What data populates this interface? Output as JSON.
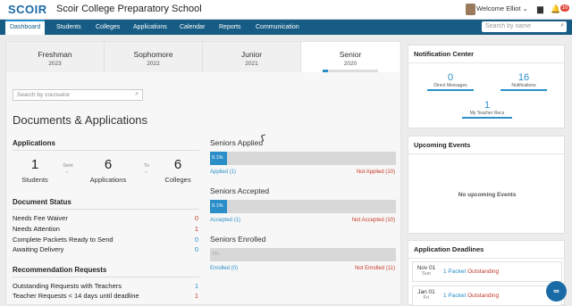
{
  "header": {
    "logo": "SCOIR",
    "school_name": "Scoir College Preparatory School",
    "welcome": "Welcome Elliot ⌄",
    "notification_badge": "10"
  },
  "nav": {
    "tabs": [
      "Dashboard",
      "Students",
      "Colleges",
      "Applications",
      "Calendar",
      "Reports",
      "Communication"
    ],
    "search_placeholder": "Search by name"
  },
  "class_tabs": [
    {
      "name": "Freshman",
      "year": "2023"
    },
    {
      "name": "Sophomore",
      "year": "2022"
    },
    {
      "name": "Junior",
      "year": "2021"
    },
    {
      "name": "Senior",
      "year": "2020",
      "progress": 0.091
    }
  ],
  "counselor_search": {
    "placeholder": "Search by counselor"
  },
  "page_title": "Documents & Applications",
  "applications": {
    "heading": "Applications",
    "students_count": "1",
    "students_label": "Students",
    "sent_label": "Sent",
    "applications_count": "6",
    "applications_label": "Applications",
    "to_label": "To",
    "colleges_count": "6",
    "colleges_label": "Colleges"
  },
  "document_status": {
    "heading": "Document Status",
    "rows": [
      {
        "label": "Needs Fee Waiver",
        "value": "0",
        "color": "#c53a2a"
      },
      {
        "label": "Needs Attention",
        "value": "1",
        "color": "#c53a2a"
      },
      {
        "label": "Complete Packets Ready to Send",
        "value": "0",
        "color": "#2a8ec8"
      },
      {
        "label": "Awaiting Delivery",
        "value": "0",
        "color": "#2a8ec8"
      }
    ]
  },
  "recommendation_requests": {
    "heading": "Recommendation Requests",
    "rows": [
      {
        "label": "Outstanding Requests with Teachers",
        "value": "1",
        "color": "#2a8ec8"
      },
      {
        "label": "Teacher Requests < 14 days until deadline",
        "value": "1",
        "color": "#c53a2a"
      }
    ]
  },
  "senior_bars": [
    {
      "title": "Seniors Applied",
      "percent_label": "9.1%",
      "fraction": 0.091,
      "left_label": "Applied (1)",
      "right_label": "Not Applied (10)"
    },
    {
      "title": "Seniors Accepted",
      "percent_label": "9.1%",
      "fraction": 0.091,
      "left_label": "Accepted (1)",
      "right_label": "Not Accepted (10)"
    },
    {
      "title": "Seniors Enrolled",
      "percent_label": "0%",
      "fraction": 0,
      "left_label": "Enrolled (0)",
      "right_label": "Not Enrolled (11)"
    }
  ],
  "notification_center": {
    "heading": "Notification Center",
    "items": [
      {
        "count": "0",
        "label": "Direct Messages"
      },
      {
        "count": "16",
        "label": "Notifications"
      },
      {
        "count": "1",
        "label": "My Teacher Recs"
      }
    ]
  },
  "upcoming_events": {
    "heading": "Upcoming Events",
    "empty_text": "No upcoming Events"
  },
  "application_deadlines": {
    "heading": "Application Deadlines",
    "rows": [
      {
        "date": "Nov 01",
        "day": "Sun",
        "packet": "1 Packet",
        "status": "Outstanding"
      },
      {
        "date": "Jan 01",
        "day": "Fri",
        "packet": "1 Packet",
        "status": "Outstanding"
      }
    ]
  },
  "colors": {
    "brand": "#165c84",
    "accent": "#2a8ec8",
    "alert": "#c53a2a"
  },
  "icons": [
    "search-icon",
    "chat-icon",
    "bell-icon",
    "chevron-down-icon",
    "arrow-right-icon",
    "chat-bubble-icon"
  ]
}
